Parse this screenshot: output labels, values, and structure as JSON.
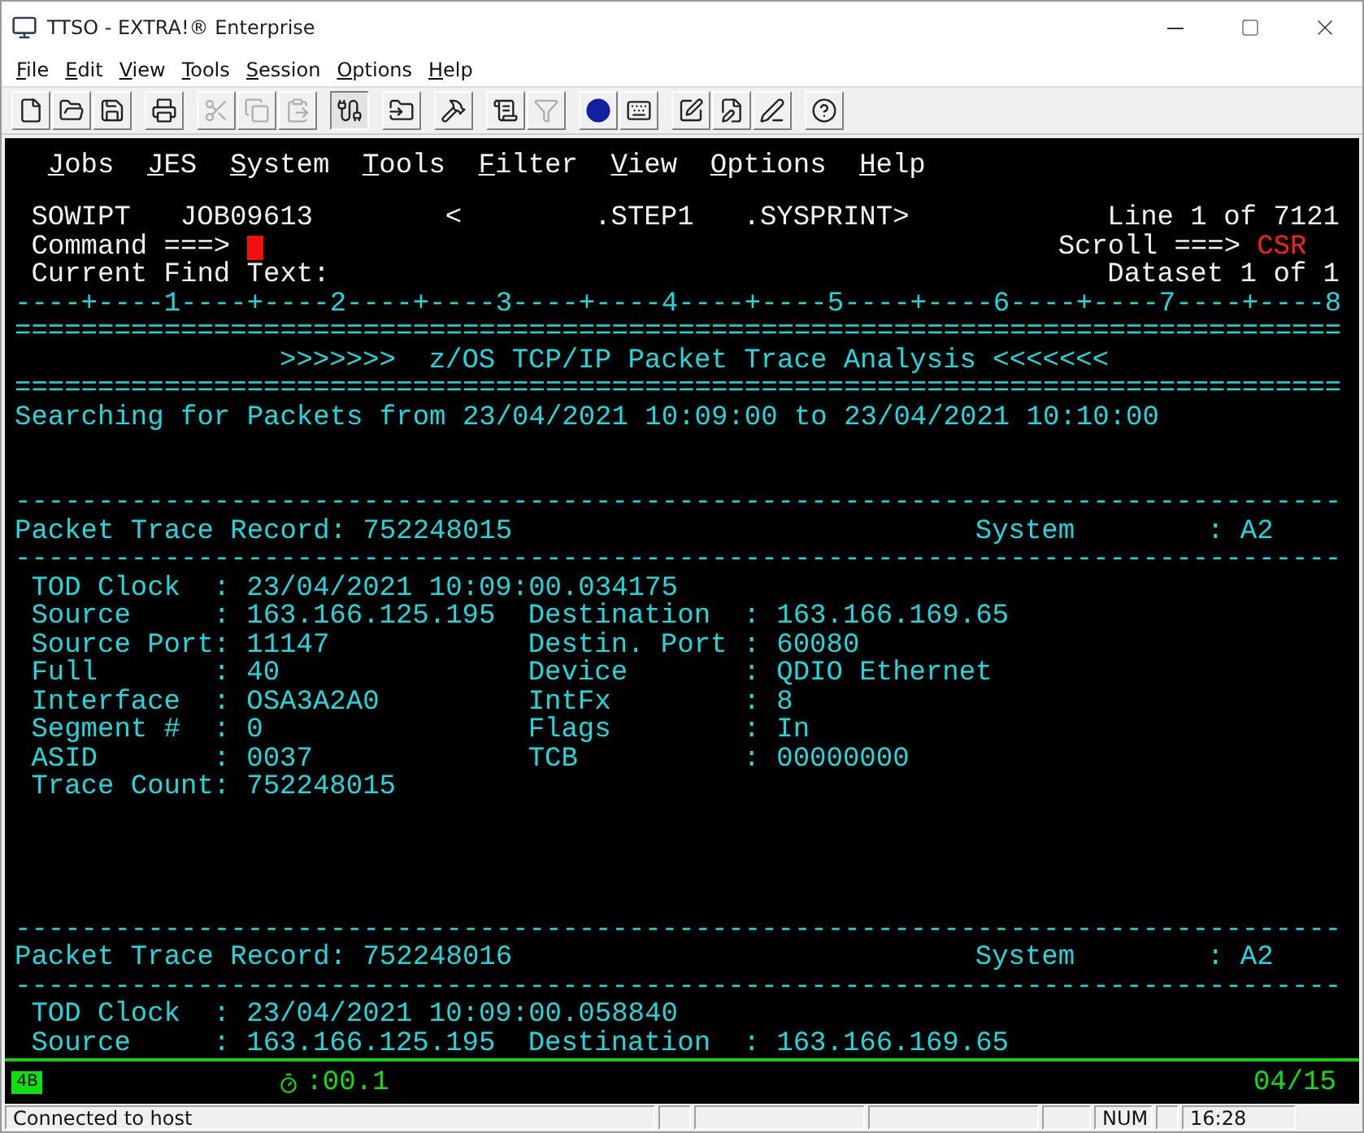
{
  "window": {
    "title": "TTSO - EXTRA!® Enterprise"
  },
  "menu": [
    "File",
    "Edit",
    "View",
    "Tools",
    "Session",
    "Options",
    "Help"
  ],
  "toolbar": [
    {
      "kind": "new",
      "disabled": false,
      "pressed": false
    },
    {
      "kind": "open",
      "disabled": false,
      "pressed": false
    },
    {
      "kind": "save",
      "disabled": false,
      "pressed": false
    },
    {
      "kind": "print",
      "disabled": false,
      "pressed": false
    },
    {
      "kind": "cut",
      "disabled": true,
      "pressed": false
    },
    {
      "kind": "copy",
      "disabled": true,
      "pressed": false
    },
    {
      "kind": "paste",
      "disabled": true,
      "pressed": false
    },
    {
      "kind": "connect",
      "disabled": false,
      "pressed": true
    },
    {
      "kind": "transfer",
      "disabled": false,
      "pressed": false
    },
    {
      "kind": "tools",
      "disabled": false,
      "pressed": false
    },
    {
      "kind": "report",
      "disabled": false,
      "pressed": false
    },
    {
      "kind": "filter",
      "disabled": true,
      "pressed": false
    },
    {
      "kind": "record",
      "disabled": false,
      "pressed": false
    },
    {
      "kind": "keyboard",
      "disabled": false,
      "pressed": false
    },
    {
      "kind": "edit",
      "disabled": false,
      "pressed": false
    },
    {
      "kind": "edit2",
      "disabled": false,
      "pressed": false
    },
    {
      "kind": "edit3",
      "disabled": false,
      "pressed": false
    },
    {
      "kind": "help",
      "disabled": false,
      "pressed": false
    }
  ],
  "terminal": {
    "menu": [
      "Jobs",
      "JES",
      "System",
      "Tools",
      "Filter",
      "View",
      "Options",
      "Help"
    ],
    "header": {
      "user": "SOWIPT",
      "job": "JOB09613",
      "open": "<",
      "step": ".STEP1",
      "dd": ".SYSPRINT>",
      "line": "Line 1 of 7121",
      "command_label": "Command ===>",
      "scroll_label": "Scroll ===>",
      "scroll": "CSR",
      "find_label": "Current Find Text:",
      "dataset": "Dataset 1 of 1"
    },
    "ruler": "----+----1----+----2----+----3----+----4----+----5----+----6----+----7----+----8",
    "rule_top": "================================================================================",
    "banner": ">>>>>>>  z/OS TCP/IP Packet Trace Analysis <<<<<<<",
    "rule_bottom": "================================================================================",
    "search_line": "Searching for Packets from 23/04/2021 10:09:00 to 23/04/2021 10:10:00",
    "records": [
      {
        "rule_top": "--------------------------------------------------------------------------------",
        "title": "Packet Trace Record: 752248015",
        "system_label": "System",
        "system": ": A2",
        "rule_bottom": "--------------------------------------------------------------------------------",
        "fields": [
          {
            "label": "TOD Clock",
            "value": ": 23/04/2021 10:09:00.034175"
          },
          {
            "label": "Source",
            "value": ": 163.166.125.195",
            "label2": "Destination",
            "value2": ": 163.166.169.65"
          },
          {
            "label": "Source Port",
            "value": ": 11147",
            "label2": "Destin. Port",
            "value2": ": 60080"
          },
          {
            "label": "Full",
            "value": ": 40",
            "label2": "Device",
            "value2": ": QDIO Ethernet"
          },
          {
            "label": "Interface",
            "value": ": OSA3A2A0",
            "label2": "IntFx",
            "value2": ": 8"
          },
          {
            "label": "Segment #",
            "value": ": 0",
            "label2": "Flags",
            "value2": ": In"
          },
          {
            "label": "ASID",
            "value": ": 0037",
            "label2": "TCB",
            "value2": ": 00000000"
          },
          {
            "label": "Trace Count",
            "value": ": 752248015"
          }
        ]
      },
      {
        "rule_top": "--------------------------------------------------------------------------------",
        "title": "Packet Trace Record: 752248016",
        "system_label": "System",
        "system": ": A2",
        "rule_bottom": "--------------------------------------------------------------------------------",
        "fields": [
          {
            "label": "TOD Clock",
            "value": ": 23/04/2021 10:09:00.058840"
          },
          {
            "label": "Source",
            "value": ": 163.166.125.195",
            "label2": "Destination",
            "value2": ": 163.166.169.65"
          }
        ]
      }
    ]
  },
  "status_line": {
    "session": "4B",
    "timer": ":00.1",
    "position": "04/15"
  },
  "status_bar": {
    "message": "Connected to host",
    "num": "NUM",
    "time": "16:28"
  }
}
